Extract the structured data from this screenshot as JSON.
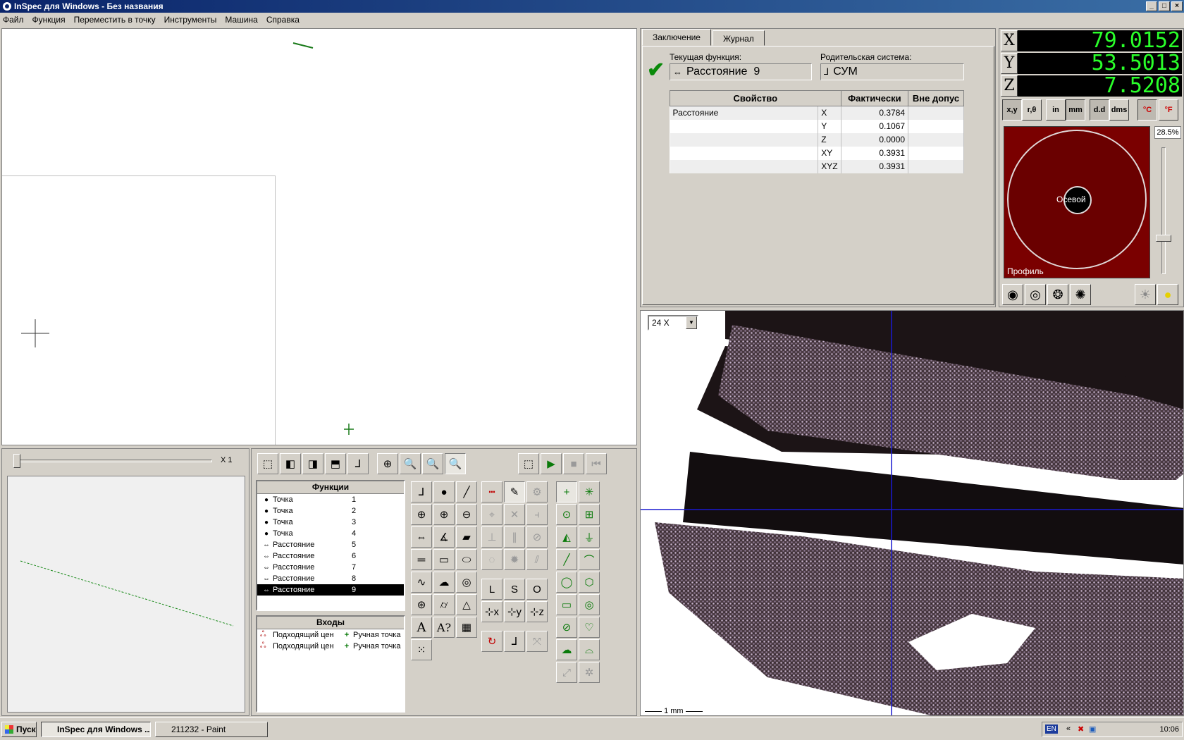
{
  "window": {
    "title": "InSpec для Windows - Без названия"
  },
  "menu": [
    "Файл",
    "Функция",
    "Переместить в точку",
    "Инструменты",
    "Машина",
    "Справка"
  ],
  "profile": {
    "zoom_label": "X 1"
  },
  "features": {
    "header": "Функции",
    "items": [
      {
        "icon": "point-icon",
        "name": "Точка",
        "num": "1"
      },
      {
        "icon": "point-icon",
        "name": "Точка",
        "num": "2"
      },
      {
        "icon": "point-icon",
        "name": "Точка",
        "num": "3"
      },
      {
        "icon": "point-icon",
        "name": "Точка",
        "num": "4"
      },
      {
        "icon": "distance-icon",
        "name": "Расстояние",
        "num": "5"
      },
      {
        "icon": "distance-icon",
        "name": "Расстояние",
        "num": "6"
      },
      {
        "icon": "distance-icon",
        "name": "Расстояние",
        "num": "7"
      },
      {
        "icon": "distance-icon",
        "name": "Расстояние",
        "num": "8"
      },
      {
        "icon": "distance-icon",
        "name": "Расстояние",
        "num": "9"
      }
    ],
    "selected_index": 8
  },
  "inputs": {
    "header": "Входы",
    "items": [
      {
        "name": "Подходящий цен",
        "point": "Ручная точка"
      },
      {
        "name": "Подходящий цен",
        "point": "Ручная точка"
      }
    ]
  },
  "results": {
    "tabs": [
      "Заключение",
      "Журнал"
    ],
    "current_label": "Текущая функция:",
    "current_value": "Расстояние  9",
    "parent_label": "Родительская система:",
    "parent_value": "СУМ",
    "table": {
      "headers": [
        "Свойство",
        "Фактически",
        "Вне допус"
      ],
      "rows": [
        {
          "prop": "Расстояние",
          "axis": "X",
          "value": "0.3784",
          "out": ""
        },
        {
          "prop": "",
          "axis": "Y",
          "value": "0.1067",
          "out": ""
        },
        {
          "prop": "",
          "axis": "Z",
          "value": "0.0000",
          "out": ""
        },
        {
          "prop": "",
          "axis": "XY",
          "value": "0.3931",
          "out": ""
        },
        {
          "prop": "",
          "axis": "XYZ",
          "value": "0.3931",
          "out": ""
        }
      ]
    }
  },
  "dro": {
    "x_label": "X",
    "x_value": "79.0152",
    "y_label": "Y",
    "y_value": "53.5013",
    "z_label": "Z",
    "z_value": "7.5208",
    "units": [
      "x,y",
      "r,θ",
      "in",
      "mm",
      "d.d",
      "dms",
      "°C",
      "°F"
    ],
    "percent": "28.5%",
    "axial_label": "Осевой",
    "profile_label": "Профиль"
  },
  "camera": {
    "zoom": "24 X",
    "scale": "1 mm"
  },
  "taskbar": {
    "start": "Пуск",
    "items": [
      "InSpec для Windows ...",
      "211232 - Paint"
    ],
    "lang": "EN",
    "time": "10:06"
  },
  "colors": {
    "dro_text": "#2aff2a",
    "light_ring": "#7a0000",
    "title_gradient_start": "#0a246a"
  }
}
